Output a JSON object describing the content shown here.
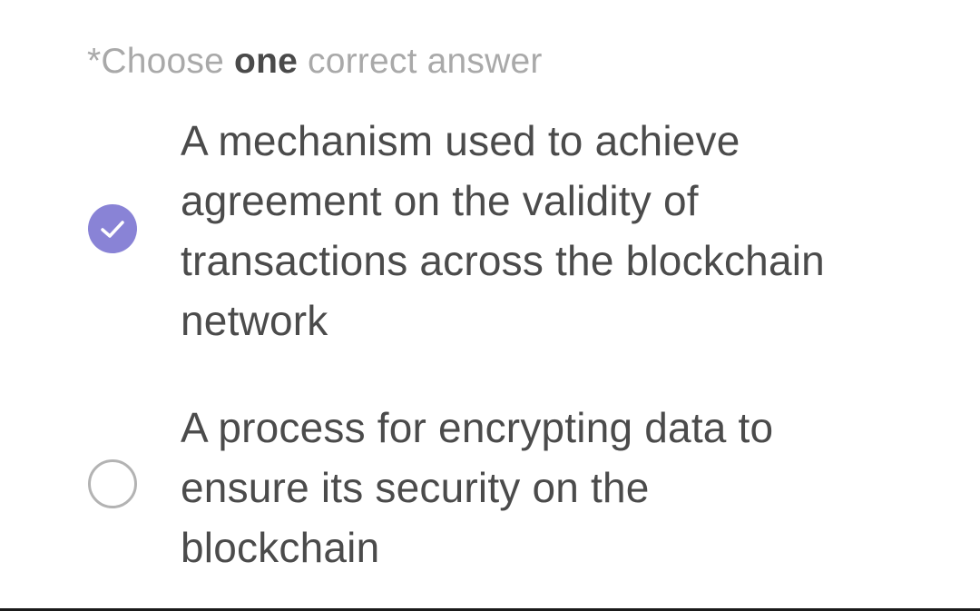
{
  "instruction": {
    "prefix": "*Choose ",
    "emphasis": "one",
    "suffix": " correct answer"
  },
  "options": [
    {
      "lines": [
        "A mechanism used to achieve",
        "agreement on the validity of",
        "transactions across the blockchain",
        "network"
      ],
      "selected": true
    },
    {
      "lines": [
        "A process for encrypting data to",
        "ensure its security on the",
        "blockchain"
      ],
      "selected": false
    }
  ],
  "colors": {
    "accent": "#8983d6",
    "text": "#4b4b4b",
    "muted": "#a9a9a9",
    "radio_border": "#b3b3b3"
  },
  "icons": {
    "selected": "check-icon",
    "unselected": "radio-empty-icon"
  }
}
